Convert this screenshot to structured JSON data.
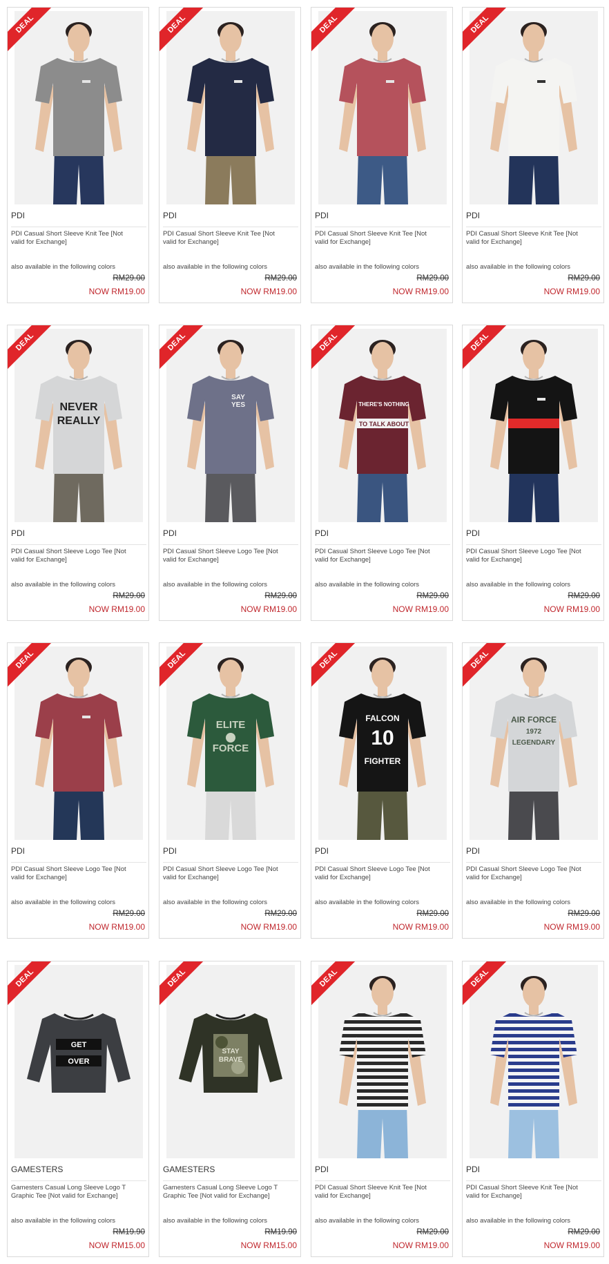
{
  "deal_label": "DEAL",
  "avail_label": "also available in the following colors",
  "colors": {
    "deal": "#e0252a",
    "now_price": "#c0272d"
  },
  "products": [
    {
      "brand": "PDI",
      "name": "PDI Casual Short Sleeve Knit Tee [Not valid for Exchange]",
      "old_price": "RM29.00",
      "now_price": "NOW RM19.00",
      "style": "tee",
      "shirt": "#8c8c8c",
      "pants": "#27375d",
      "print": "logo"
    },
    {
      "brand": "PDI",
      "name": "PDI Casual Short Sleeve Knit Tee [Not valid for Exchange]",
      "old_price": "RM29.00",
      "now_price": "NOW RM19.00",
      "style": "tee",
      "shirt": "#232a44",
      "pants": "#8b7b5c",
      "print": "logo"
    },
    {
      "brand": "PDI",
      "name": "PDI Casual Short Sleeve Knit Tee [Not valid for Exchange]",
      "old_price": "RM29.00",
      "now_price": "NOW RM19.00",
      "style": "tee",
      "shirt": "#b5525c",
      "pants": "#3d5a86",
      "print": "logo"
    },
    {
      "brand": "PDI",
      "name": "PDI Casual Short Sleeve Knit Tee [Not valid for Exchange]",
      "old_price": "RM29.00",
      "now_price": "NOW RM19.00",
      "style": "tee",
      "shirt": "#f4f4f2",
      "pants": "#23345a",
      "print": "logo"
    },
    {
      "brand": "PDI",
      "name": "PDI Casual Short Sleeve Logo Tee [Not valid for Exchange]",
      "old_price": "RM29.00",
      "now_price": "NOW RM19.00",
      "style": "tee",
      "shirt": "#d5d6d7",
      "pants": "#6f6a5f",
      "print": "NEVER REALLY",
      "print_color": "#222"
    },
    {
      "brand": "PDI",
      "name": "PDI Casual Short Sleeve Logo Tee [Not valid for Exchange]",
      "old_price": "RM29.00",
      "now_price": "NOW RM19.00",
      "style": "tee",
      "shirt": "#6e7189",
      "pants": "#5a5a5e",
      "print": "SAY YES",
      "print_color": "#f2f2f2"
    },
    {
      "brand": "PDI",
      "name": "PDI Casual Short Sleeve Logo Tee [Not valid for Exchange]",
      "old_price": "RM29.00",
      "now_price": "NOW RM19.00",
      "style": "tee",
      "shirt": "#6b2430",
      "pants": "#3a5580",
      "print": "THERE'S NOTHING TO TALK ABOUT",
      "print_color": "#ffffff",
      "stripe": "#f2f2f2"
    },
    {
      "brand": "PDI",
      "name": "PDI Casual Short Sleeve Logo Tee [Not valid for Exchange]",
      "old_price": "RM29.00",
      "now_price": "NOW RM19.00",
      "style": "tee",
      "shirt": "#141414",
      "pants": "#22345c",
      "print": "logo",
      "stripe": "#e02a2a"
    },
    {
      "brand": "PDI",
      "name": "PDI Casual Short Sleeve Logo Tee [Not valid for Exchange]",
      "old_price": "RM29.00",
      "now_price": "NOW RM19.00",
      "style": "tee",
      "shirt": "#9b3f4a",
      "pants": "#243758",
      "print": "logo",
      "print_color": "#ffffff"
    },
    {
      "brand": "PDI",
      "name": "PDI Casual Short Sleeve Logo Tee [Not valid for Exchange]",
      "old_price": "RM29.00",
      "now_price": "NOW RM19.00",
      "style": "tee",
      "shirt": "#2c5a3c",
      "pants": "#d9d9d9",
      "print": "ELITE FORCE",
      "print_color": "#c8d2c0"
    },
    {
      "brand": "PDI",
      "name": "PDI Casual Short Sleeve Logo Tee [Not valid for Exchange]",
      "old_price": "RM29.00",
      "now_price": "NOW RM19.00",
      "style": "tee",
      "shirt": "#151515",
      "pants": "#57583e",
      "print": "FALCON 10 FIGHTER",
      "print_color": "#ffffff"
    },
    {
      "brand": "PDI",
      "name": "PDI Casual Short Sleeve Logo Tee [Not valid for Exchange]",
      "old_price": "RM29.00",
      "now_price": "NOW RM19.00",
      "style": "tee",
      "shirt": "#d4d6d8",
      "pants": "#4a4a4e",
      "print": "AIR FORCE 1972 LEGENDARY",
      "print_color": "#4b5a4a"
    },
    {
      "brand": "GAMESTERS",
      "name": "Gamesters Casual Long Sleeve Logo T Graphic Tee [Not valid for Exchange]",
      "old_price": "RM19.90",
      "now_price": "NOW RM15.00",
      "style": "flat",
      "shirt": "#3c3e42",
      "print": "GET OVER",
      "print_color": "#ffffff"
    },
    {
      "brand": "GAMESTERS",
      "name": "Gamesters Casual Long Sleeve Logo T Graphic Tee [Not valid for Exchange]",
      "old_price": "RM19.90",
      "now_price": "NOW RM15.00",
      "style": "flat",
      "shirt": "#2f3326",
      "print": "STAY BRAVE",
      "print_color": "#e0e0d0"
    },
    {
      "brand": "PDI",
      "name": "PDI Casual Short Sleeve Knit Tee [Not valid for Exchange]",
      "old_price": "RM29.00",
      "now_price": "NOW RM19.00",
      "style": "tee",
      "shirt": "stripe-black",
      "pants": "#8cb4d8",
      "print": ""
    },
    {
      "brand": "PDI",
      "name": "PDI Casual Short Sleeve Knit Tee [Not valid for Exchange]",
      "old_price": "RM29.00",
      "now_price": "NOW RM19.00",
      "style": "tee",
      "shirt": "stripe-blue",
      "pants": "#9cc0e0",
      "print": ""
    }
  ]
}
